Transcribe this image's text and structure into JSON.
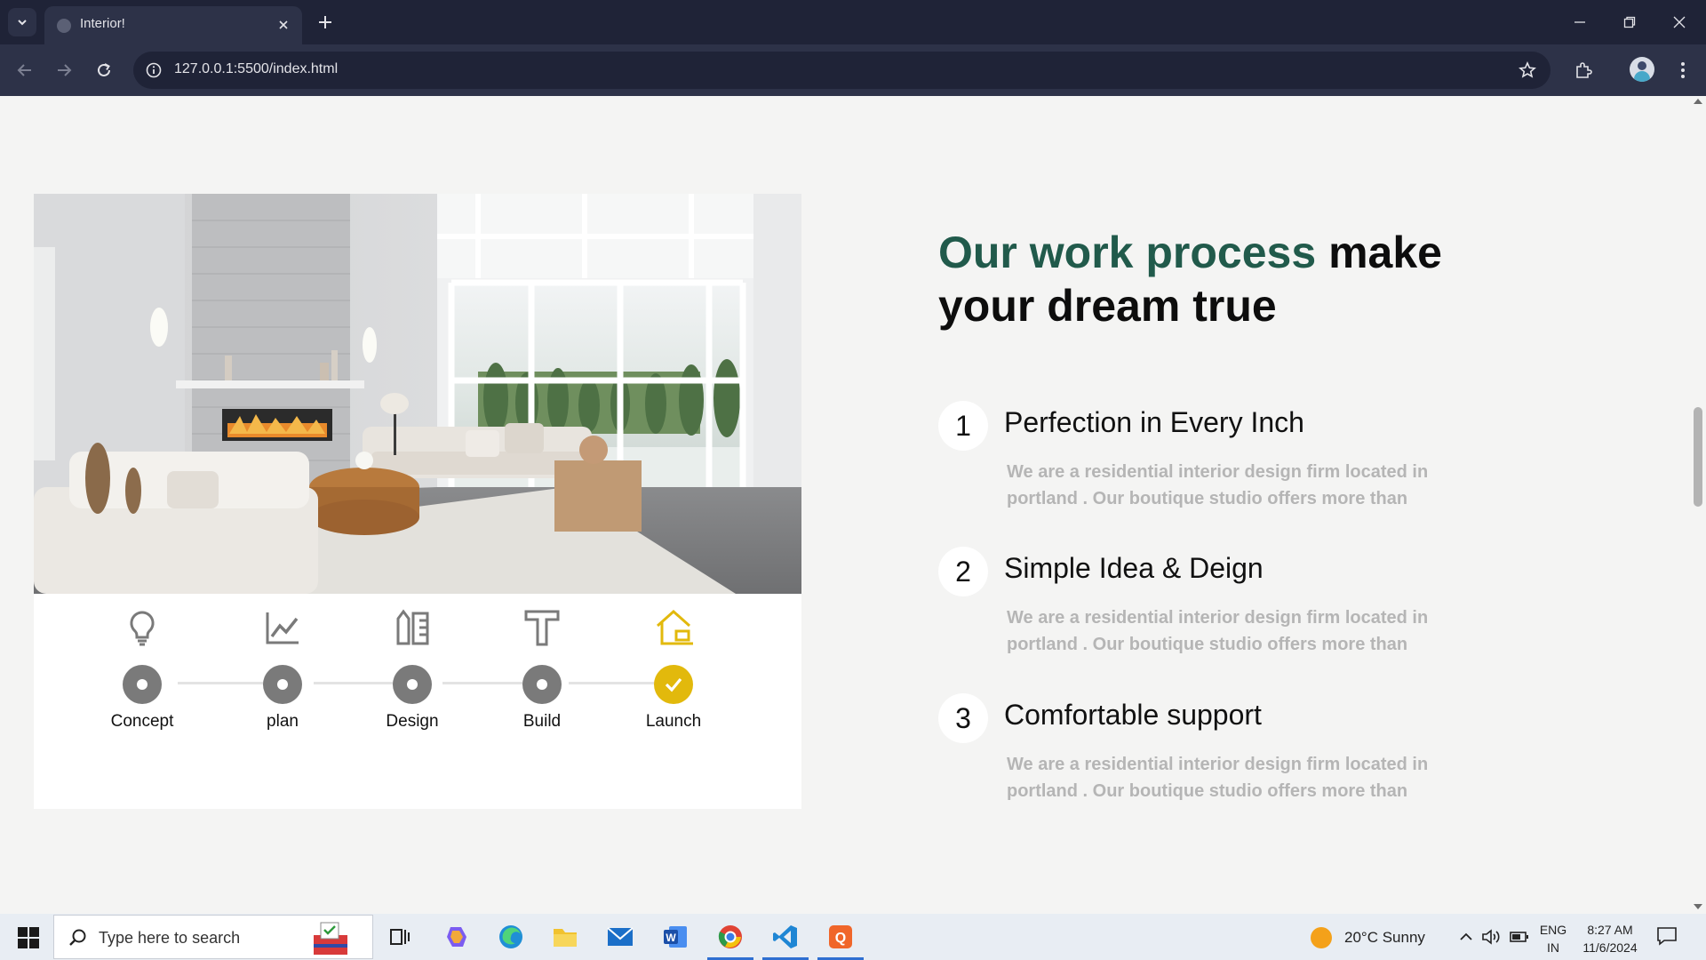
{
  "browser": {
    "tab_title": "Interior!",
    "url": "127.0.0.1:5500/index.html"
  },
  "process": {
    "steps": [
      {
        "label": "Concept",
        "icon": "lightbulb-icon",
        "completed": false
      },
      {
        "label": "plan",
        "icon": "chart-icon",
        "completed": false
      },
      {
        "label": "Design",
        "icon": "ruler-pencil-icon",
        "completed": false
      },
      {
        "label": "Build",
        "icon": "hammer-icon",
        "completed": false
      },
      {
        "label": "Launch",
        "icon": "house-icon",
        "completed": true
      }
    ]
  },
  "section": {
    "heading_accent": "Our work process",
    "heading_rest_line1": "make",
    "heading_rest_line2": "your dream true",
    "accent_color": "#215a4b",
    "highlight_color": "#e2b90c",
    "features": [
      {
        "number": "1",
        "title": "Perfection in Every Inch",
        "desc_line1": "We are a residential interior design firm located in",
        "desc_line2": "portland . Our boutique studio offers more than"
      },
      {
        "number": "2",
        "title": "Simple Idea & Deign",
        "desc_line1": "We are a residential interior design firm located in",
        "desc_line2": "portland . Our boutique studio offers more than"
      },
      {
        "number": "3",
        "title": "Comfortable support",
        "desc_line1": "We are a residential interior design firm located in",
        "desc_line2": "portland . Our boutique studio offers more than"
      }
    ]
  },
  "taskbar": {
    "search_placeholder": "Type here to search",
    "weather": "20°C  Sunny",
    "lang_line1": "ENG",
    "lang_line2": "IN",
    "time": "8:27 AM",
    "date": "11/6/2024"
  }
}
